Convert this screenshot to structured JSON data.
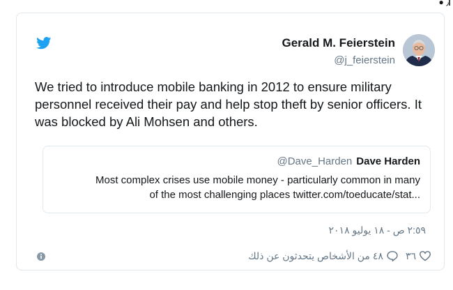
{
  "tweet": {
    "author_name": "Gerald M. Feierstein",
    "author_handle": "@j_feierstein",
    "text": "We tried to introduce mobile banking in 2012 to ensure military personnel received their pay and help stop theft by senior officers. It was blocked by Ali Mohsen and others.",
    "timestamp": "٢:٥٩ ص - ١٨ يوليو ٢٠١٨",
    "like_count": "٣٦",
    "reply_count": "٤٨",
    "reply_text": "من الأشخاص يتحدثون عن ذلك"
  },
  "quoted": {
    "handle": "@Dave_Harden",
    "name": "Dave Harden",
    "text_line1": "Most complex crises use mobile money - particularly common in many",
    "text_line2": "of the most challenging places twitter.com/toeducate/stat..."
  },
  "icons": {
    "brand": "twitter-bird-icon",
    "like": "heart-icon",
    "reply": "speech-bubble-icon",
    "info": "info-icon"
  },
  "colors": {
    "twitter_blue": "#1da1f2",
    "text": "#14171a",
    "secondary_text": "#657786",
    "border": "#e1e8ed"
  }
}
